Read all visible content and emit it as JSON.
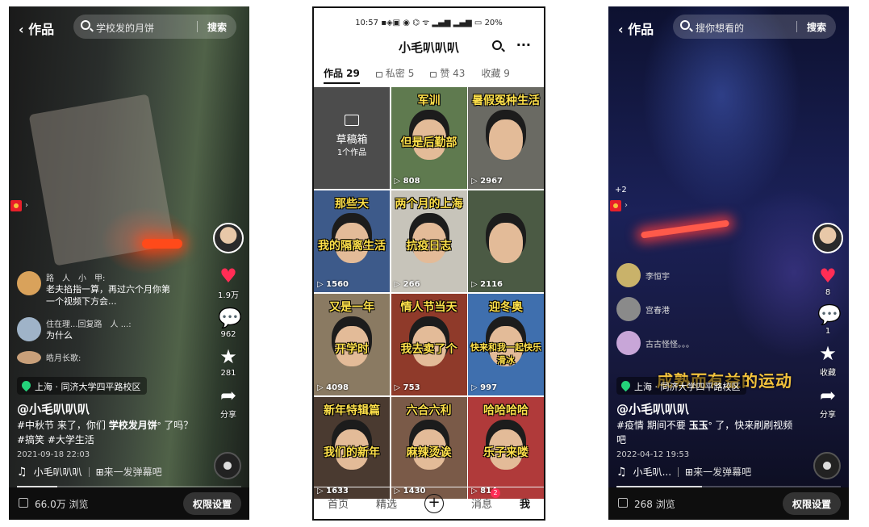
{
  "left": {
    "back_label": "作品",
    "search_query": "学校发的月饼",
    "search_button": "搜索",
    "likes": "1.9万",
    "comments_count": "962",
    "favorites": "281",
    "share": "分享",
    "comments": [
      {
        "name": "路　人　小　甲:",
        "text": "老夫掐指一算，再过六个月你第一个视频下方会..."
      },
      {
        "name": "住在理...回复路　人 ...:",
        "text": "为什么"
      },
      {
        "name": "皓月长歌:",
        "text": ""
      }
    ],
    "location": "上海 · 同济大学四平路校区",
    "author": "@小毛叭叭叭",
    "desc_pre": "#中秋节 来了，你们 ",
    "desc_hl": "学校发月饼",
    "desc_post": "ᐤ 了吗？ #搞笑 #大学生活",
    "date": "2021-09-18 22:03",
    "music": "小毛叭叭叭",
    "danmaku": "来一发弹幕吧",
    "views": "66.0万 浏览",
    "permission": "权限设置"
  },
  "middle": {
    "status_time": "10:57",
    "status_battery": "20%",
    "title": "小毛叭叭叭",
    "tabs": [
      {
        "label": "作品 29"
      },
      {
        "label": "私密 5"
      },
      {
        "label": "赞 43"
      },
      {
        "label": "收藏 9"
      }
    ],
    "draft_title": "草稿箱",
    "draft_count": "1个作品",
    "videos": [
      {
        "caption": "军训 但是后勤部",
        "plays": "808",
        "bg": "#5f7a4f"
      },
      {
        "caption": "暑假冤种生活",
        "plays": "2967",
        "bg": "#6a6a63"
      },
      {
        "caption": "那些天 我的隔离生活",
        "plays": "1560",
        "bg": "#3d5a8a"
      },
      {
        "caption": "两个月的上海 抗疫日志",
        "plays": "266",
        "bg": "#c7c4ba"
      },
      {
        "caption": "",
        "plays": "2116",
        "bg": "#4b5a44"
      },
      {
        "caption": "又是一年 开学时",
        "plays": "4098",
        "bg": "#8a7a62"
      },
      {
        "caption": "情人节当天 我去卖了个",
        "plays": "753",
        "bg": "#8f3a2a"
      },
      {
        "caption": "迎冬奥 快来和我一起快乐滑冰",
        "plays": "997",
        "bg": "#3f6fae"
      },
      {
        "caption": "新年特辑篇 我们的新年",
        "plays": "1633",
        "bg": "#4a3a30"
      },
      {
        "caption": "六合六利 麻辣烫诶",
        "plays": "1430",
        "bg": "#7a5a48"
      },
      {
        "caption": "哈哈哈哈 乐子来喽",
        "plays": "814",
        "bg": "#b03a3a"
      }
    ],
    "nav": [
      {
        "label": "首页"
      },
      {
        "label": "精选"
      },
      {
        "label": "+"
      },
      {
        "label": "消息"
      },
      {
        "label": "我"
      }
    ],
    "msg_badge": "2"
  },
  "right": {
    "back_label": "作品",
    "search_placeholder": "搜你想看的",
    "search_button": "搜索",
    "badge_plus": "+2",
    "likes": "8",
    "comments_count": "1",
    "favorites": "收藏",
    "share": "分享",
    "comments": [
      {
        "name": "李恒宇",
        "text": ""
      },
      {
        "name": "宫春港",
        "text": ""
      },
      {
        "name": "古古怪怪。。。",
        "text": ""
      }
    ],
    "overlay_text": "成熟而有益的运动",
    "location": "上海 · 同济大学四平路校区",
    "author": "@小毛叭叭叭",
    "desc_pre": "#疫情 期间不要 ",
    "desc_hl": "玉玉",
    "desc_post": "ᐤ 了，快来刷刷视频吧",
    "date": "2022-04-12 19:53",
    "music": "小毛叭...",
    "danmaku": "来一发弹幕吧",
    "views": "268 浏览",
    "permission": "权限设置"
  }
}
